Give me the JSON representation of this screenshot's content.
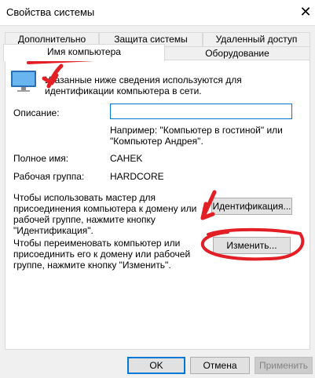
{
  "window": {
    "title": "Свойства системы"
  },
  "tabs_row1": [
    "Дополнительно",
    "Защита системы",
    "Удаленный доступ"
  ],
  "tabs_row2": [
    "Имя компьютера",
    "Оборудование"
  ],
  "info_text_lines": [
    "Указанные ниже сведения используются для",
    "идентификации компьютера в сети."
  ],
  "description": {
    "label": "Описание:",
    "value": "",
    "hint_lines": [
      "Например: \"Компьютер в гостиной\" или",
      "\"Компьютер Андрея\"."
    ]
  },
  "full_name": {
    "label": "Полное имя:",
    "value": "CAHEK"
  },
  "workgroup": {
    "label": "Рабочая группа:",
    "value": "HARDCORE"
  },
  "identification": {
    "text_lines": [
      "Чтобы использовать мастер для",
      "присоединения компьютера к домену или",
      "рабочей группе, нажмите кнопку",
      "\"Идентификация\"."
    ],
    "button": "Идентификация..."
  },
  "rename": {
    "text_lines": [
      "Чтобы переименовать компьютер или",
      "присоединить его к домену или рабочей",
      "группе, нажмите кнопку \"Изменить\"."
    ],
    "button": "Изменить..."
  },
  "footer": {
    "ok": "OK",
    "cancel": "Отмена",
    "apply": "Применить"
  },
  "icons": {
    "close": "close-icon",
    "computer": "computer-icon"
  }
}
